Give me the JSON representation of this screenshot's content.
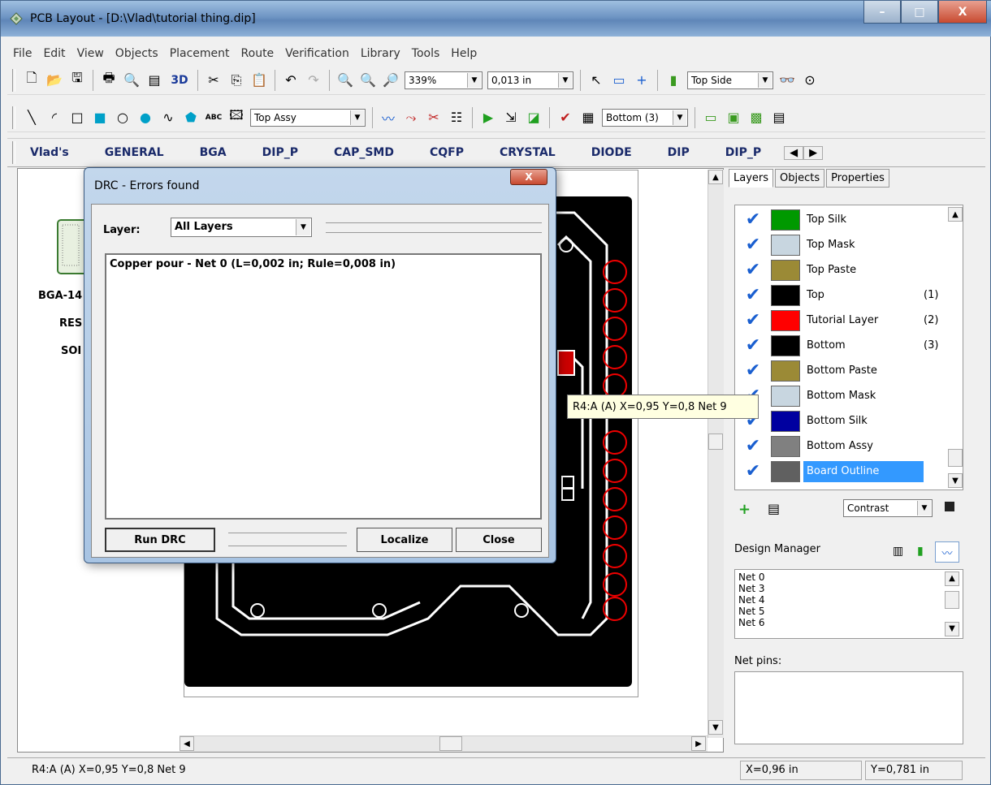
{
  "window": {
    "title": "PCB Layout - [D:\\Vlad\\tutorial thing.dip]",
    "controls": [
      "–",
      "□",
      "X"
    ]
  },
  "menu": [
    "File",
    "Edit",
    "View",
    "Objects",
    "Placement",
    "Route",
    "Verification",
    "Library",
    "Tools",
    "Help"
  ],
  "toolbar1": {
    "zoom": "339%",
    "grid": "0,013 in",
    "label_3d": "3D",
    "side": "Top Side"
  },
  "toolbar2": {
    "layer_left": "Top Assy",
    "abc_label": "ABC",
    "layer_right": "Bottom (3)"
  },
  "library_tabs": [
    "Vlad's",
    "GENERAL",
    "BGA",
    "DIP_P",
    "CAP_SMD",
    "CQFP",
    "CRYSTAL",
    "DIODE",
    "DIP",
    "DIP_P"
  ],
  "left_list": [
    "BGA-14",
    "RES",
    "SOI"
  ],
  "dialog": {
    "title": "DRC - Errors found",
    "close": "X",
    "layer_label": "Layer:",
    "layer_value": "All Layers",
    "error": "Copper pour - Net 0  (L=0,002 in; Rule=0,008 in)",
    "run_btn": "Run DRC",
    "localize_btn": "Localize",
    "close_btn": "Close"
  },
  "tooltip": "R4:A (A)  X=0,95  Y=0,8  Net 9",
  "panel": {
    "tabs": [
      "Layers",
      "Objects",
      "Properties"
    ],
    "layers": [
      {
        "name": "Top Silk",
        "color": "#009900",
        "num": ""
      },
      {
        "name": "Top Mask",
        "color": "#c8d6e0",
        "num": ""
      },
      {
        "name": "Top Paste",
        "color": "#9b8a36",
        "num": ""
      },
      {
        "name": "Top",
        "color": "#000000",
        "num": "(1)"
      },
      {
        "name": "Tutorial Layer",
        "color": "#ff0000",
        "num": "(2)"
      },
      {
        "name": "Bottom",
        "color": "#000000",
        "num": "(3)"
      },
      {
        "name": "Bottom Paste",
        "color": "#9b8a36",
        "num": ""
      },
      {
        "name": "Bottom Mask",
        "color": "#c8d6e0",
        "num": ""
      },
      {
        "name": "Bottom Silk",
        "color": "#0000a0",
        "num": ""
      },
      {
        "name": "Bottom Assy",
        "color": "#808080",
        "num": ""
      },
      {
        "name": "Board Outline",
        "color": "#606060",
        "num": ""
      }
    ],
    "contrast": "Contrast",
    "design_manager": "Design Manager",
    "nets": [
      "Net 0",
      "Net 3",
      "Net 4",
      "Net 5",
      "Net 6"
    ],
    "net_pins_label": "Net pins:"
  },
  "status": {
    "info": "R4:A (A)  X=0,95  Y=0,8  Net 9",
    "x": "X=0,96 in",
    "y": "Y=0,781 in"
  }
}
